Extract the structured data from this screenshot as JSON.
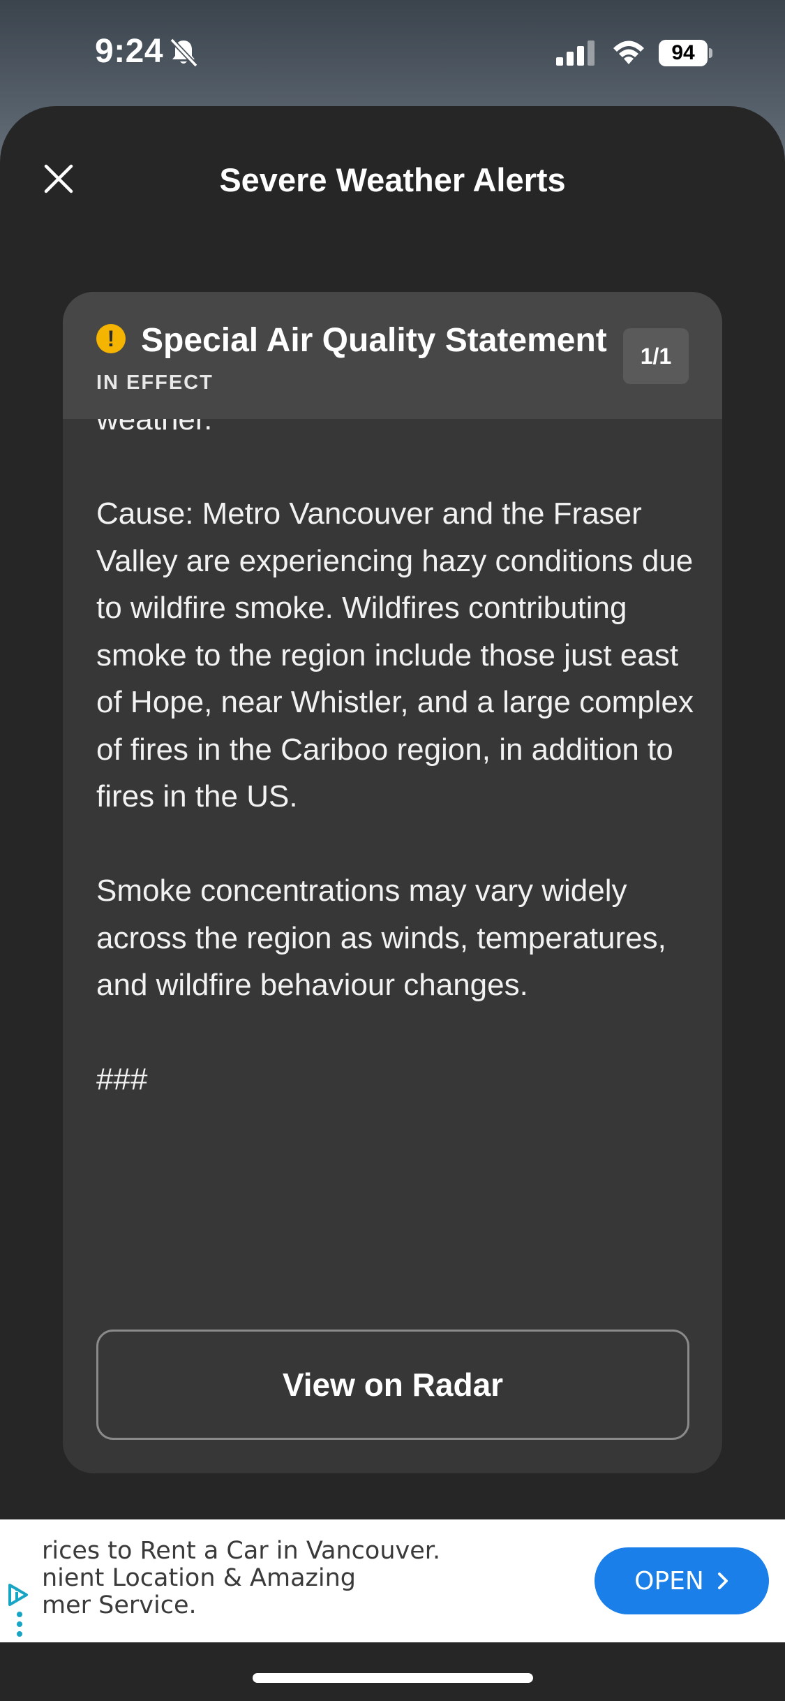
{
  "status_bar": {
    "time": "9:24",
    "battery": "94"
  },
  "header": {
    "title": "Severe Weather Alerts"
  },
  "alert": {
    "title": "Special Air Quality Statement",
    "status": "IN EFFECT",
    "pager": "1/1",
    "paragraphs": [
      "weather.",
      "Cause: Metro Vancouver and the Fraser Valley are experiencing hazy conditions due to wildfire smoke. Wildfires contributing smoke to the region include those just east of Hope, near Whistler, and a large complex of fires in the Cariboo region, in addition to fires in the US.",
      "Smoke concentrations may vary widely across the region as winds, temperatures, and wildfire behaviour changes.",
      "###"
    ],
    "radar_button": "View on Radar"
  },
  "ad": {
    "lines": [
      "rices to Rent a Car in Vancouver.",
      "nient Location & Amazing",
      "mer Service."
    ],
    "cta": "OPEN"
  },
  "colors": {
    "accent_warning": "#f4b400",
    "ad_button": "#1a7fe8",
    "sheet_bg": "#262626",
    "card_bg": "#373737",
    "card_header_bg": "#474747"
  }
}
